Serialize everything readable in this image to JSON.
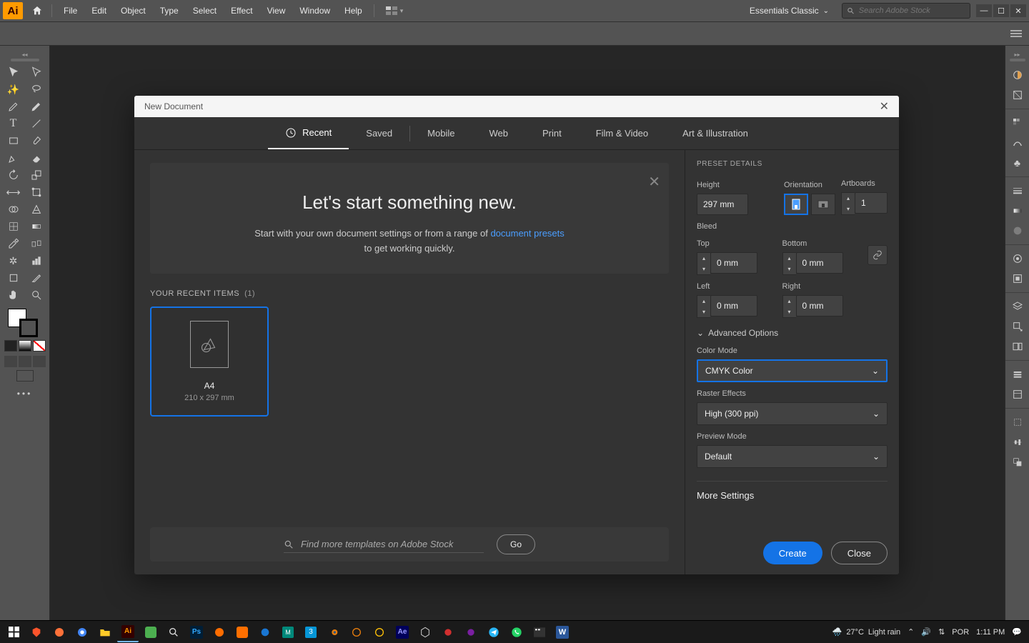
{
  "menubar": {
    "logo": "Ai",
    "items": [
      "File",
      "Edit",
      "Object",
      "Type",
      "Select",
      "Effect",
      "View",
      "Window",
      "Help"
    ],
    "workspace": "Essentials Classic",
    "search_placeholder": "Search Adobe Stock"
  },
  "dialog": {
    "title": "New Document",
    "tabs": [
      "Recent",
      "Saved",
      "Mobile",
      "Web",
      "Print",
      "Film & Video",
      "Art & Illustration"
    ],
    "active_tab": 0,
    "hero": {
      "heading": "Let's start something new.",
      "line1_a": "Start with your own document settings or from a range of ",
      "line1_link": "document presets",
      "line2": "to get working quickly."
    },
    "recent": {
      "label": "YOUR RECENT ITEMS",
      "count": "(1)",
      "items": [
        {
          "name": "A4",
          "dim": "210 x 297 mm"
        }
      ]
    },
    "stock_placeholder": "Find more templates on Adobe Stock",
    "go": "Go",
    "preset": {
      "section": "PRESET DETAILS",
      "height_label": "Height",
      "height": "297 mm",
      "orientation_label": "Orientation",
      "artboards_label": "Artboards",
      "artboards": "1",
      "bleed_label": "Bleed",
      "top": "Top",
      "bottom": "Bottom",
      "left": "Left",
      "right": "Right",
      "bleed_val": "0 mm",
      "adv": "Advanced Options",
      "color_mode_label": "Color Mode",
      "color_mode": "CMYK Color",
      "raster_label": "Raster Effects",
      "raster": "High (300 ppi)",
      "preview_label": "Preview Mode",
      "preview": "Default",
      "more": "More Settings"
    },
    "create": "Create",
    "close": "Close"
  },
  "taskbar": {
    "weather_temp": "27°C",
    "weather_desc": "Light rain",
    "lang": "POR",
    "time": "1:11 PM"
  }
}
